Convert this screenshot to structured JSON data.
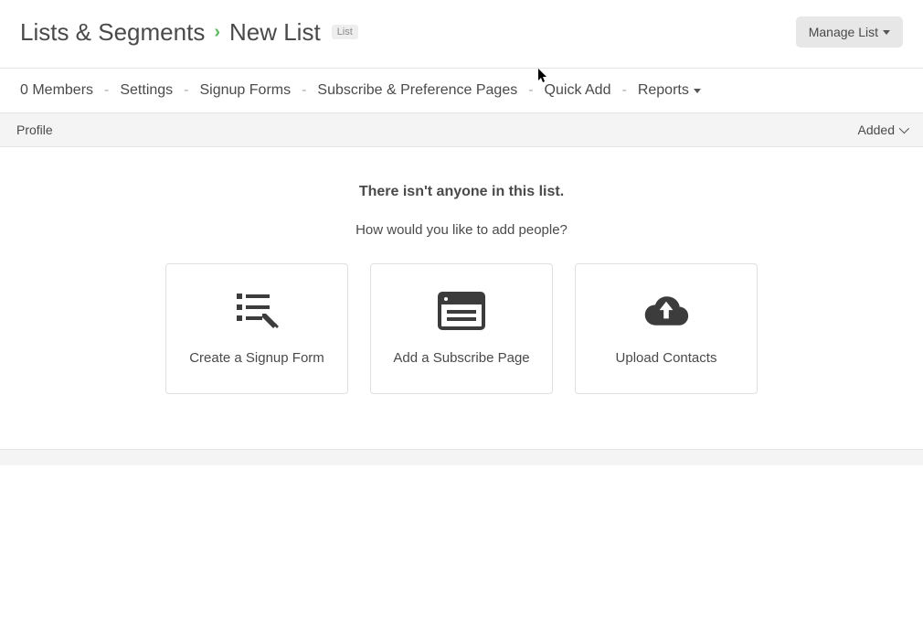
{
  "breadcrumb": {
    "root": "Lists & Segments",
    "current": "New List",
    "tag": "List"
  },
  "header": {
    "manage_label": "Manage List"
  },
  "subnav": {
    "members": "0 Members",
    "settings": "Settings",
    "signup_forms": "Signup Forms",
    "subscribe_pages": "Subscribe & Preference Pages",
    "quick_add": "Quick Add",
    "reports": "Reports"
  },
  "table_header": {
    "profile": "Profile",
    "added": "Added"
  },
  "empty_state": {
    "title": "There isn't anyone in this list.",
    "subtitle": "How would you like to add people?",
    "cards": {
      "signup_form": "Create a Signup Form",
      "subscribe_page": "Add a Subscribe Page",
      "upload_contacts": "Upload Contacts"
    }
  }
}
